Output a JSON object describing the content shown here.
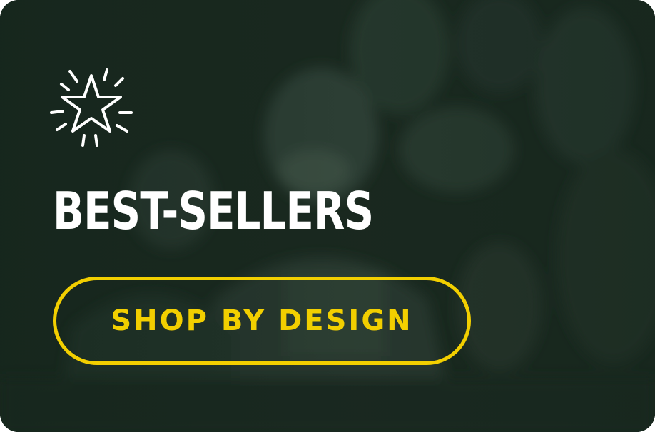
{
  "banner": {
    "title": "BEST-SELLERS",
    "icon": "sparkle-star-icon",
    "background": "fans-celebrating-photo",
    "cta_label": "SHOP BY DESIGN"
  },
  "colors": {
    "background": "#1d2a22",
    "accent": "#f2cf00",
    "text": "#ffffff"
  }
}
